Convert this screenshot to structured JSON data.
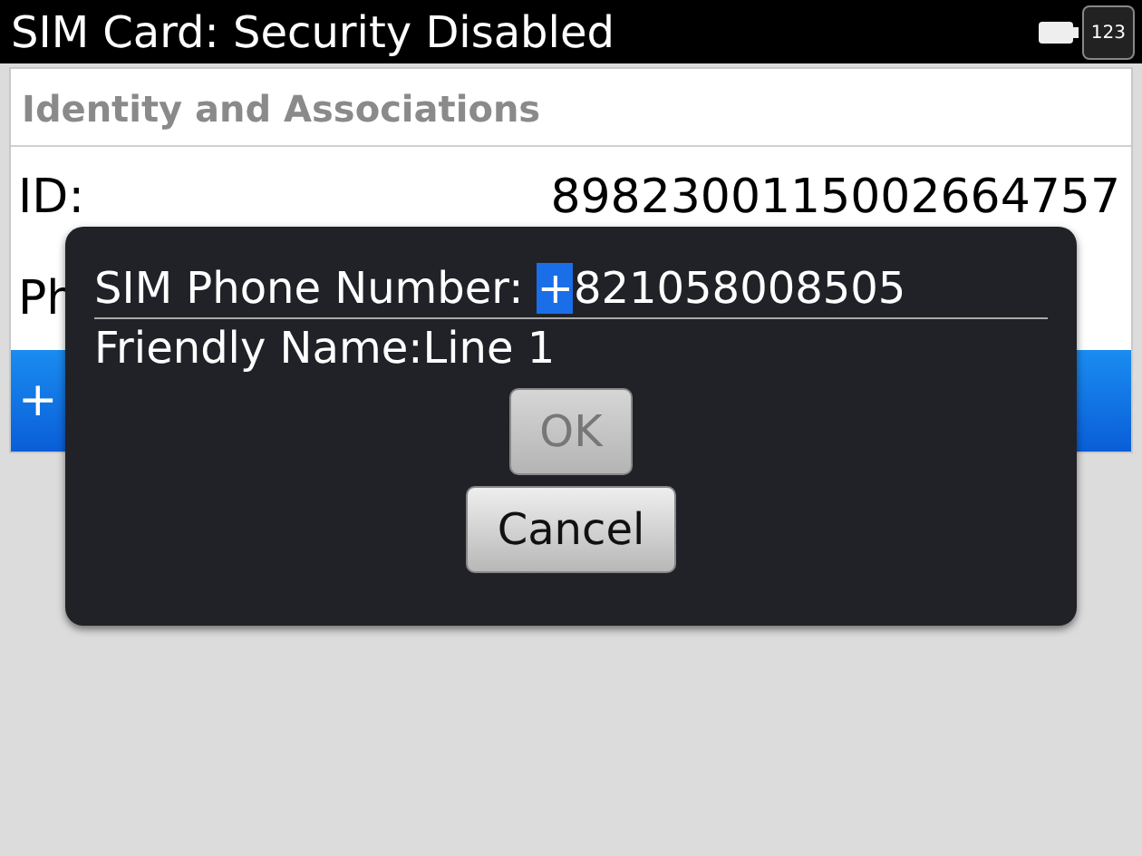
{
  "title_bar": {
    "title": "SIM Card: Security Disabled",
    "input_mode": "123"
  },
  "section": {
    "header": "Identity and Associations",
    "rows": [
      {
        "label": "ID:",
        "value": "8982300115002664757",
        "selected": false
      },
      {
        "label": "Ph",
        "value": "",
        "selected": false
      },
      {
        "label": "+",
        "value": "",
        "selected": true
      }
    ]
  },
  "dialog": {
    "field": {
      "label": "SIM Phone Number:",
      "selected_text": "+",
      "value": "821058008505"
    },
    "friendly_name": "Friendly Name:Line 1",
    "buttons": [
      {
        "label": "OK",
        "disabled": true
      },
      {
        "label": "Cancel",
        "disabled": false
      }
    ]
  }
}
